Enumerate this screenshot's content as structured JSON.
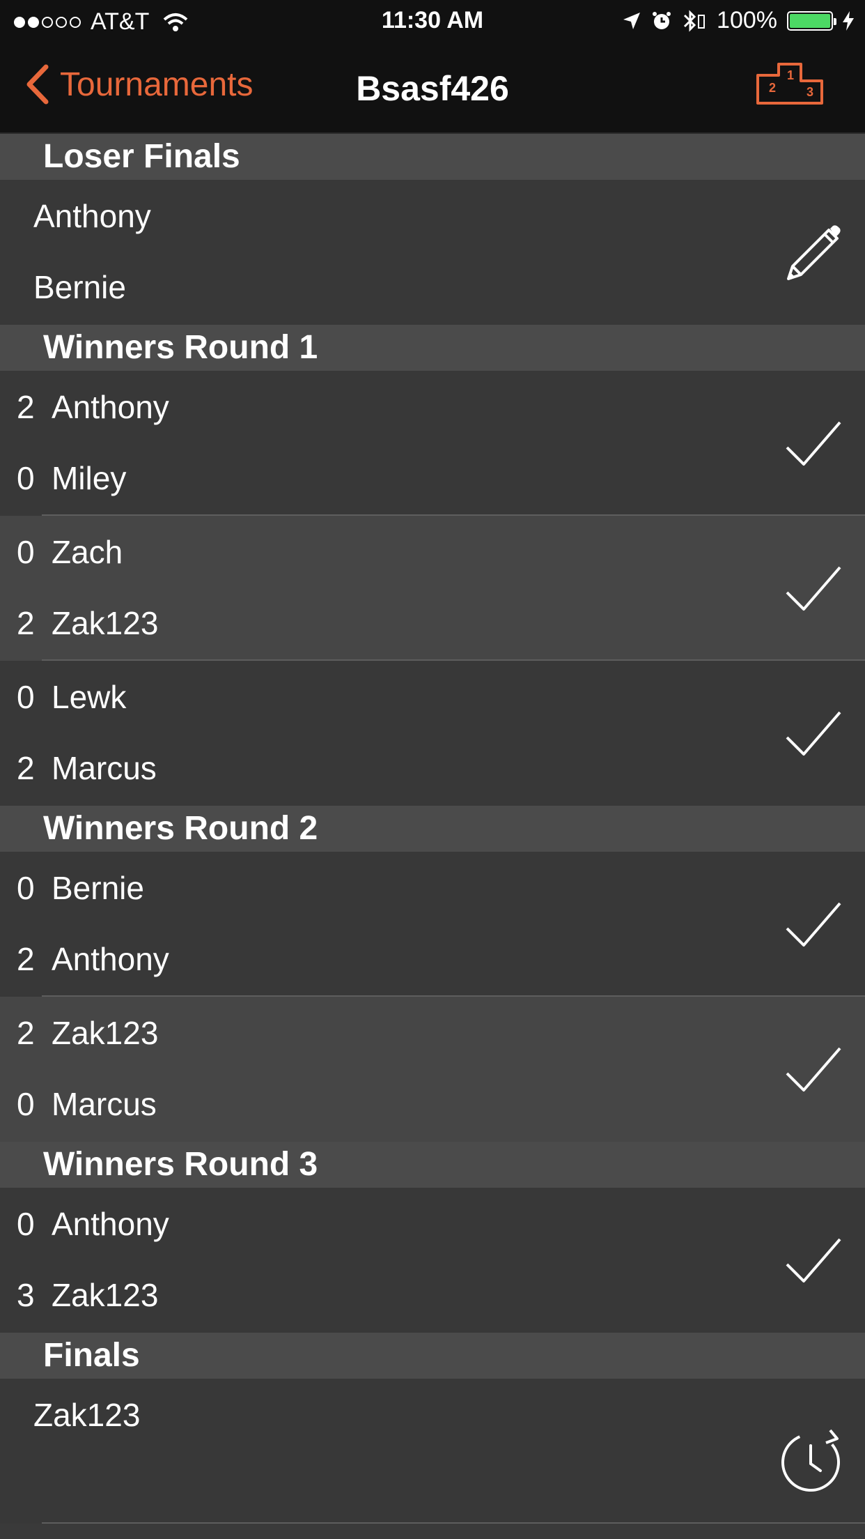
{
  "status_bar": {
    "carrier": "AT&T",
    "time": "11:30 AM",
    "battery": "100%"
  },
  "nav": {
    "back_label": "Tournaments",
    "title": "Bsasf426"
  },
  "sections": [
    {
      "title": "Loser Finals",
      "matches": [
        {
          "p1": {
            "score": "",
            "name": "Anthony"
          },
          "p2": {
            "score": "",
            "name": "Bernie"
          },
          "action": "pencil-icon"
        }
      ]
    },
    {
      "title": "Winners Round 1",
      "matches": [
        {
          "p1": {
            "score": "2",
            "name": "Anthony"
          },
          "p2": {
            "score": "0",
            "name": "Miley"
          },
          "action": "checkmark-icon"
        },
        {
          "p1": {
            "score": "0",
            "name": "Zach"
          },
          "p2": {
            "score": "2",
            "name": "Zak123"
          },
          "action": "checkmark-icon"
        },
        {
          "p1": {
            "score": "0",
            "name": "Lewk"
          },
          "p2": {
            "score": "2",
            "name": "Marcus"
          },
          "action": "checkmark-icon"
        }
      ]
    },
    {
      "title": "Winners Round 2",
      "matches": [
        {
          "p1": {
            "score": "0",
            "name": "Bernie"
          },
          "p2": {
            "score": "2",
            "name": "Anthony"
          },
          "action": "checkmark-icon"
        },
        {
          "p1": {
            "score": "2",
            "name": "Zak123"
          },
          "p2": {
            "score": "0",
            "name": "Marcus"
          },
          "action": "checkmark-icon"
        }
      ]
    },
    {
      "title": "Winners Round 3",
      "matches": [
        {
          "p1": {
            "score": "0",
            "name": "Anthony"
          },
          "p2": {
            "score": "3",
            "name": "Zak123"
          },
          "action": "checkmark-icon"
        }
      ]
    },
    {
      "title": "Finals",
      "matches": [
        {
          "p1": {
            "score": "",
            "name": "Zak123"
          },
          "p2": {
            "score": "",
            "name": ""
          },
          "action": "clock-replay-icon"
        }
      ]
    }
  ],
  "colors": {
    "accent": "#e8683b",
    "header_bg": "#4b4b4b",
    "row_bg": "#383838",
    "row_alt_bg": "#464646",
    "bar_bg": "#111111",
    "battery": "#4cd964"
  }
}
